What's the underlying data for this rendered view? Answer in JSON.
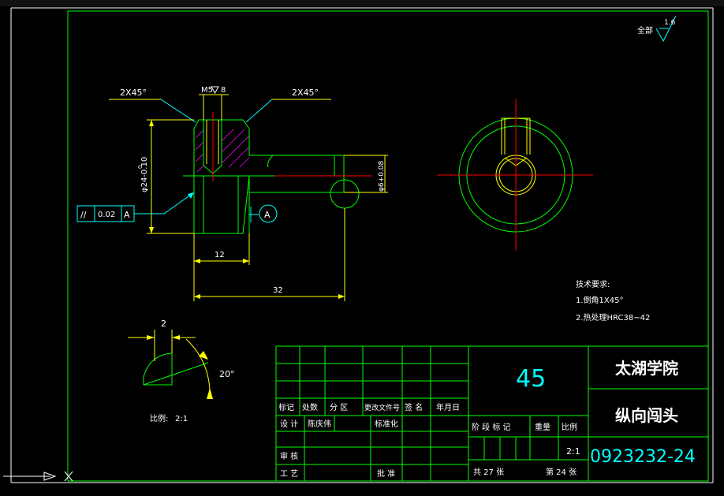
{
  "drawing": {
    "roughness_symbol": {
      "label": "全部",
      "value": "1.6"
    },
    "front_view": {
      "chamfer_left": "2X45°",
      "thread_callout": "M5",
      "thread_depth": "8",
      "chamfer_right": "2X45°",
      "dia_main": "φ24-0.10",
      "dia_main_upper": "0",
      "dia_pin": "φ6+0.08",
      "dia_pin_upper": "+0.08",
      "dim_12": "12",
      "dim_32": "32",
      "tolerance_symbol": "//",
      "tolerance_value": "0.02",
      "tolerance_datum": "A",
      "datum_label": "A"
    },
    "detail_view": {
      "dim": "2",
      "angle": "20°",
      "scale_label": "比例:",
      "scale_value": "2:1"
    },
    "tech_requirements": {
      "title": "技术要求:",
      "item1": "1.倒角1X45°",
      "item2": "2.热处理HRC38~42"
    }
  },
  "title_block": {
    "material": "45",
    "school": "太湖学院",
    "part_name": "纵向闯头",
    "drawing_no": "0923232-24",
    "scale": "2:1",
    "row_labels": {
      "mark": "标记",
      "count": "处数",
      "zone": "分 区",
      "change_doc": "更改文件号",
      "signature": "签 名",
      "date": "年月日",
      "design": "设 计",
      "designer": "陈庆伟",
      "standardize": "标准化",
      "review": "审 核",
      "process": "工 艺",
      "approve": "批 准",
      "stage_mark": "阶 段 标 记",
      "weight": "重量",
      "scale_hdr": "比例"
    },
    "sheets_total": "共 27 张",
    "sheet_no": "第 24 张"
  },
  "colors": {
    "background": "#000000",
    "outline": "#00ff00",
    "dimension": "#ffff00",
    "annotation": "#00ffff",
    "centerline": "#ff0000",
    "hatch": "#ff00ff",
    "white": "#ffffff"
  }
}
